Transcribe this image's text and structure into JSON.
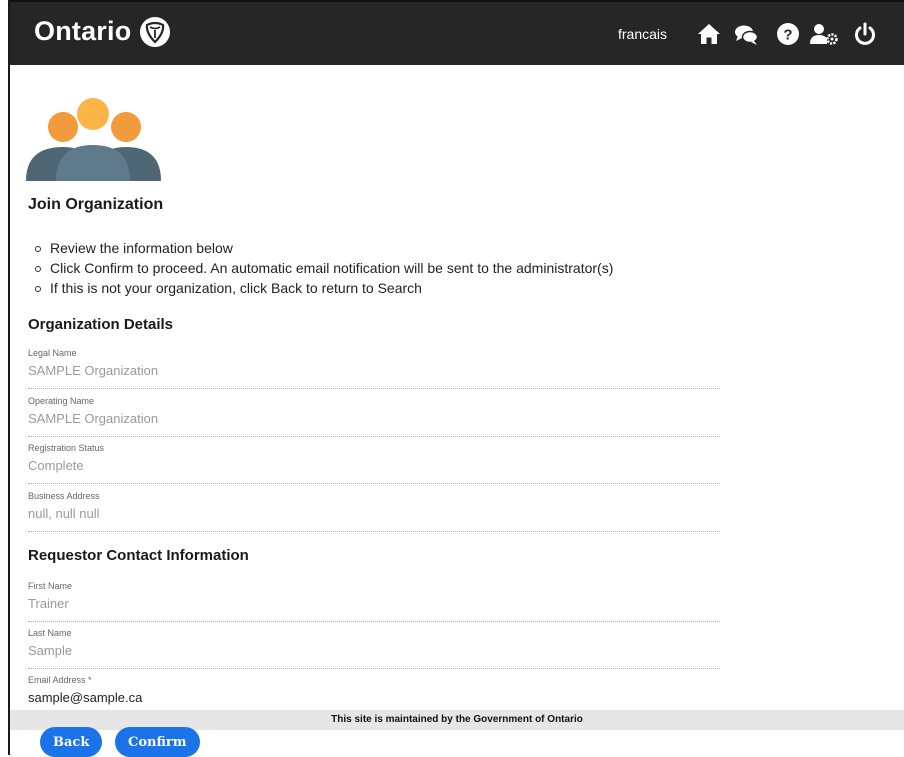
{
  "header": {
    "brand": "Ontario",
    "language_link": "francais",
    "icons": [
      "home-icon",
      "chat-icon",
      "help-icon",
      "user-settings-icon",
      "power-icon"
    ]
  },
  "page": {
    "title": "Join Organization",
    "instructions": [
      "Review the information below",
      "Click Confirm to proceed. An automatic email notification will be sent to the administrator(s)",
      "If this is not your organization, click Back to return to Search"
    ]
  },
  "org_details": {
    "heading": "Organization Details",
    "legal_name": {
      "label": "Legal Name",
      "value": "SAMPLE Organization"
    },
    "operating_name": {
      "label": "Operating Name",
      "value": "SAMPLE Organization"
    },
    "registration_status": {
      "label": "Registration Status",
      "value": "Complete"
    },
    "business_address": {
      "label": "Business Address",
      "value": "null, null null"
    }
  },
  "requestor": {
    "heading": "Requestor Contact Information",
    "first_name": {
      "label": "First Name",
      "value": "Trainer"
    },
    "last_name": {
      "label": "Last Name",
      "value": "Sample"
    },
    "email": {
      "label": "Email Address *",
      "value": "sample@sample.ca"
    }
  },
  "footer": {
    "text": "This site is maintained by the Government of Ontario"
  },
  "actions": {
    "back_label": "Back",
    "confirm_label": "Confirm"
  },
  "colors": {
    "header_bg": "#262626",
    "accent": "#1a73e8",
    "person_orange_dark": "#f29b3c",
    "person_orange_light": "#fbb546",
    "person_slate": "#4f6675"
  }
}
